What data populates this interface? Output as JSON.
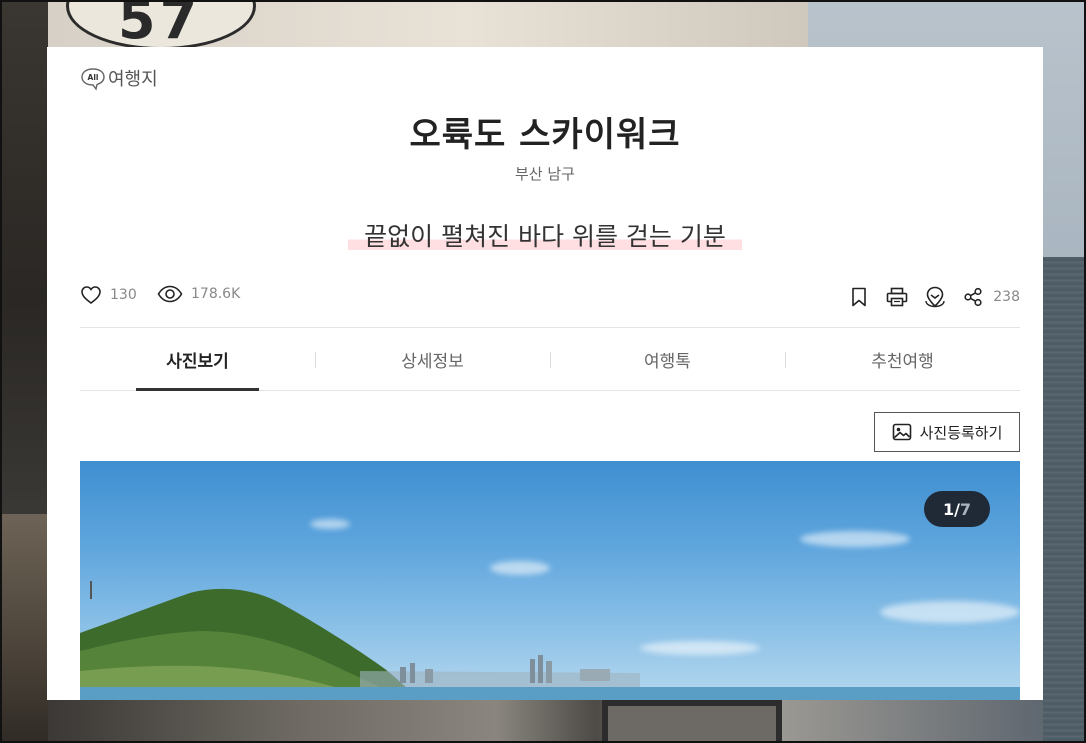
{
  "category": {
    "badge": "All",
    "label": "여행지"
  },
  "title": "오륙도 스카이워크",
  "location": "부산 남구",
  "tagline": "끝없이 펼쳐진 바다 위를 걷는 기분",
  "stats": {
    "likes": "130",
    "views": "178.6K",
    "shares": "238"
  },
  "icons": {
    "like": "heart-icon",
    "view": "eye-icon",
    "bookmark": "bookmark-icon",
    "print": "print-icon",
    "map": "map-pin-icon",
    "share": "share-icon",
    "photo": "image-icon"
  },
  "tabs": [
    {
      "label": "사진보기",
      "active": true
    },
    {
      "label": "상세정보",
      "active": false
    },
    {
      "label": "여행톡",
      "active": false
    },
    {
      "label": "추천여행",
      "active": false
    }
  ],
  "photo_button": {
    "label": "사진등록하기"
  },
  "gallery": {
    "current": "1",
    "separator": "/",
    "total": "7"
  },
  "colors": {
    "tagline_highlight": "#ffdfe1",
    "pager_bg": "#1f2a36",
    "active_tab": "#333333"
  }
}
